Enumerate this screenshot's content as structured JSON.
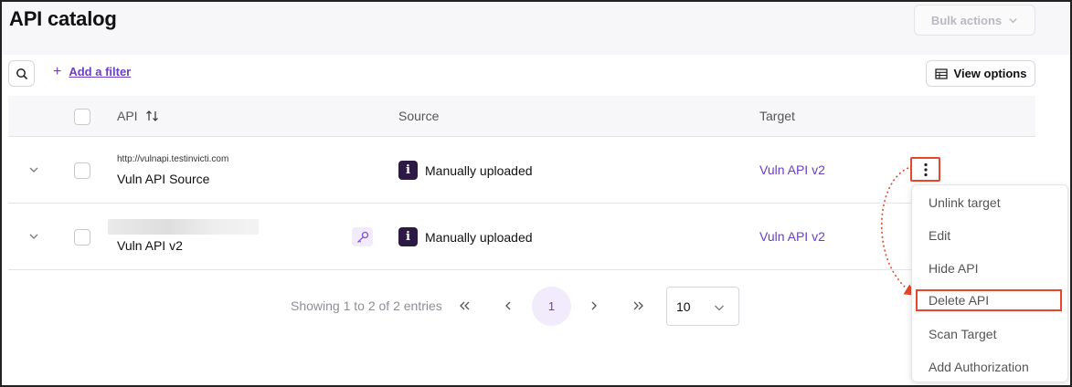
{
  "header": {
    "title": "API catalog",
    "bulk_actions_label": "Bulk actions"
  },
  "toolbar": {
    "add_filter_label": "Add a filter",
    "view_options_label": "View options"
  },
  "table": {
    "columns": {
      "api": "API",
      "source": "Source",
      "target": "Target"
    },
    "rows": [
      {
        "url": "http://vulnapi.testinvicti.com",
        "name": "Vuln API Source",
        "source": "Manually uploaded",
        "target": "Vuln API v2"
      },
      {
        "url": "",
        "name": "Vuln API v2",
        "source": "Manually uploaded",
        "target": "Vuln API v2"
      }
    ]
  },
  "pagination": {
    "summary": "Showing 1 to 2 of 2 entries",
    "current_page": "1",
    "per_page": "10"
  },
  "row_menu": {
    "items": [
      "Unlink target",
      "Edit",
      "Hide API",
      "Delete API",
      "Scan Target",
      "Add Authorization"
    ],
    "highlighted": "Delete API"
  },
  "colors": {
    "accent": "#6b3fc4",
    "highlight": "#e8462b",
    "source_icon_bg": "#2c1a44"
  },
  "icons": [
    "search-icon",
    "plus-icon",
    "table-icon",
    "sort-icon",
    "chevron-down-icon",
    "key-icon",
    "info-icon",
    "kebab-icon",
    "double-chevron-left-icon",
    "chevron-left-icon",
    "chevron-right-icon",
    "double-chevron-right-icon"
  ]
}
